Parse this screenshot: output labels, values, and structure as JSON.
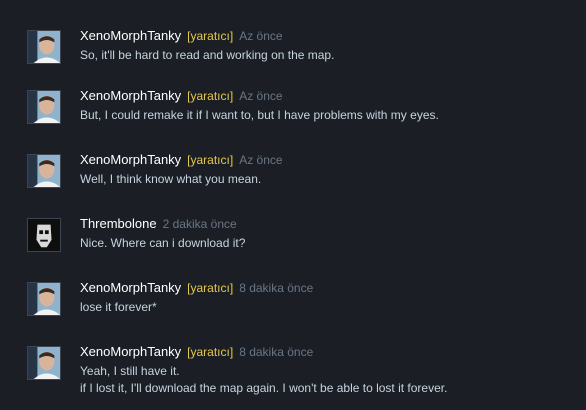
{
  "comments": [
    {
      "author": "XenoMorphTanky",
      "badge": "[yaratıcı]",
      "timestamp": "Az önce",
      "avatar": "face-photo-avatar",
      "lines": [
        "So, it'll be hard to read and working on the map."
      ]
    },
    {
      "author": "XenoMorphTanky",
      "badge": "[yaratıcı]",
      "timestamp": "Az önce",
      "avatar": "face-photo-avatar",
      "lines": [
        "But, I could remake it if I want to, but I have problems with my eyes."
      ]
    },
    {
      "author": "XenoMorphTanky",
      "badge": "[yaratıcı]",
      "timestamp": "Az önce",
      "avatar": "face-photo-avatar",
      "lines": [
        "Well, I think know what you mean."
      ]
    },
    {
      "author": "Thrembolone",
      "badge": "",
      "timestamp": "2 dakika önce",
      "avatar": "dark-figure-avatar",
      "lines": [
        "Nice. Where can i download it?"
      ]
    },
    {
      "author": "XenoMorphTanky",
      "badge": "[yaratıcı]",
      "timestamp": "8 dakika önce",
      "avatar": "face-photo-avatar",
      "lines": [
        "lose it forever*"
      ]
    },
    {
      "author": "XenoMorphTanky",
      "badge": "[yaratıcı]",
      "timestamp": "8 dakika önce",
      "avatar": "face-photo-avatar",
      "lines": [
        "Yeah, I still have it.",
        "if I lost it, I'll download the map again. I won't be able to lost it forever."
      ]
    }
  ],
  "colors": {
    "background": "#1b1f25",
    "author": "#ffffff",
    "badge": "#e5c84b",
    "timestamp": "#6a7686",
    "text": "#c6d4df"
  }
}
